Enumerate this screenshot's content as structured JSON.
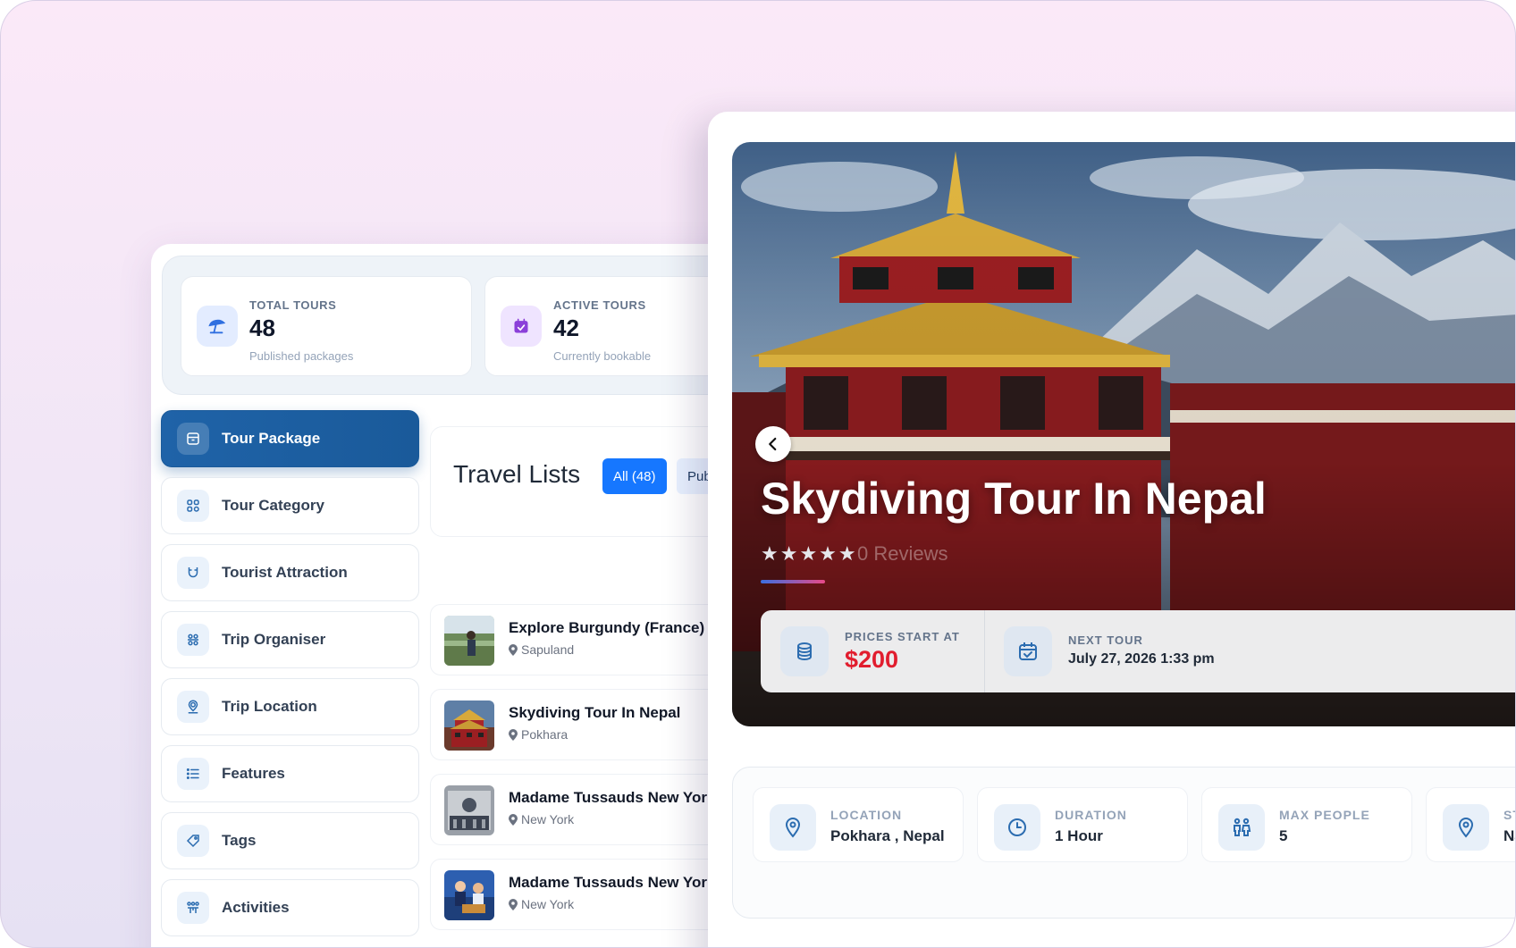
{
  "stats": [
    {
      "label": "TOTAL TOURS",
      "value": "48",
      "sub": "Published packages",
      "icon": "beach-umbrella-icon"
    },
    {
      "label": "ACTIVE TOURS",
      "value": "42",
      "sub": "Currently bookable",
      "icon": "calendar-check-icon"
    }
  ],
  "sidebar": {
    "items": [
      {
        "label": "Tour Package",
        "icon": "package-icon",
        "active": true
      },
      {
        "label": "Tour Category",
        "icon": "category-grid-icon"
      },
      {
        "label": "Tourist Attraction",
        "icon": "magnet-icon"
      },
      {
        "label": "Trip Organiser",
        "icon": "organiser-icon"
      },
      {
        "label": "Trip Location",
        "icon": "location-pin-icon"
      },
      {
        "label": "Features",
        "icon": "list-icon"
      },
      {
        "label": "Tags",
        "icon": "tag-icon"
      },
      {
        "label": "Activities",
        "icon": "activities-icon"
      }
    ]
  },
  "travel": {
    "title": "Travel Lists",
    "filter_all": "All (48)",
    "filter_published": "Pub",
    "items": [
      {
        "title": "Explore Burgundy (France)",
        "location": "Sapuland"
      },
      {
        "title": "Skydiving Tour In Nepal",
        "location": "Pokhara"
      },
      {
        "title": "Madame Tussauds New York",
        "location": "New York"
      },
      {
        "title": "Madame Tussauds New York",
        "location": "New York"
      }
    ]
  },
  "detail": {
    "title": "Skydiving Tour In Nepal",
    "stars": "★★★★★",
    "reviews": "0 Reviews",
    "price_label": "PRICES START AT",
    "price_value": "$200",
    "next_label": "NEXT TOUR",
    "next_value": "July 27, 2026 1:33 pm",
    "info": [
      {
        "label": "LOCATION",
        "value": "Pokhara , Nepal",
        "icon": "map-pin-icon"
      },
      {
        "label": "DURATION",
        "value": "1 Hour",
        "icon": "clock-icon"
      },
      {
        "label": "MAX PEOPLE",
        "value": "5",
        "icon": "people-icon"
      },
      {
        "label": "ST",
        "value": "Na",
        "icon": "map-pin-icon"
      }
    ]
  },
  "colors": {
    "accent": "#1a5a9a",
    "price": "#e11d2e",
    "pill": "#1677ff"
  }
}
